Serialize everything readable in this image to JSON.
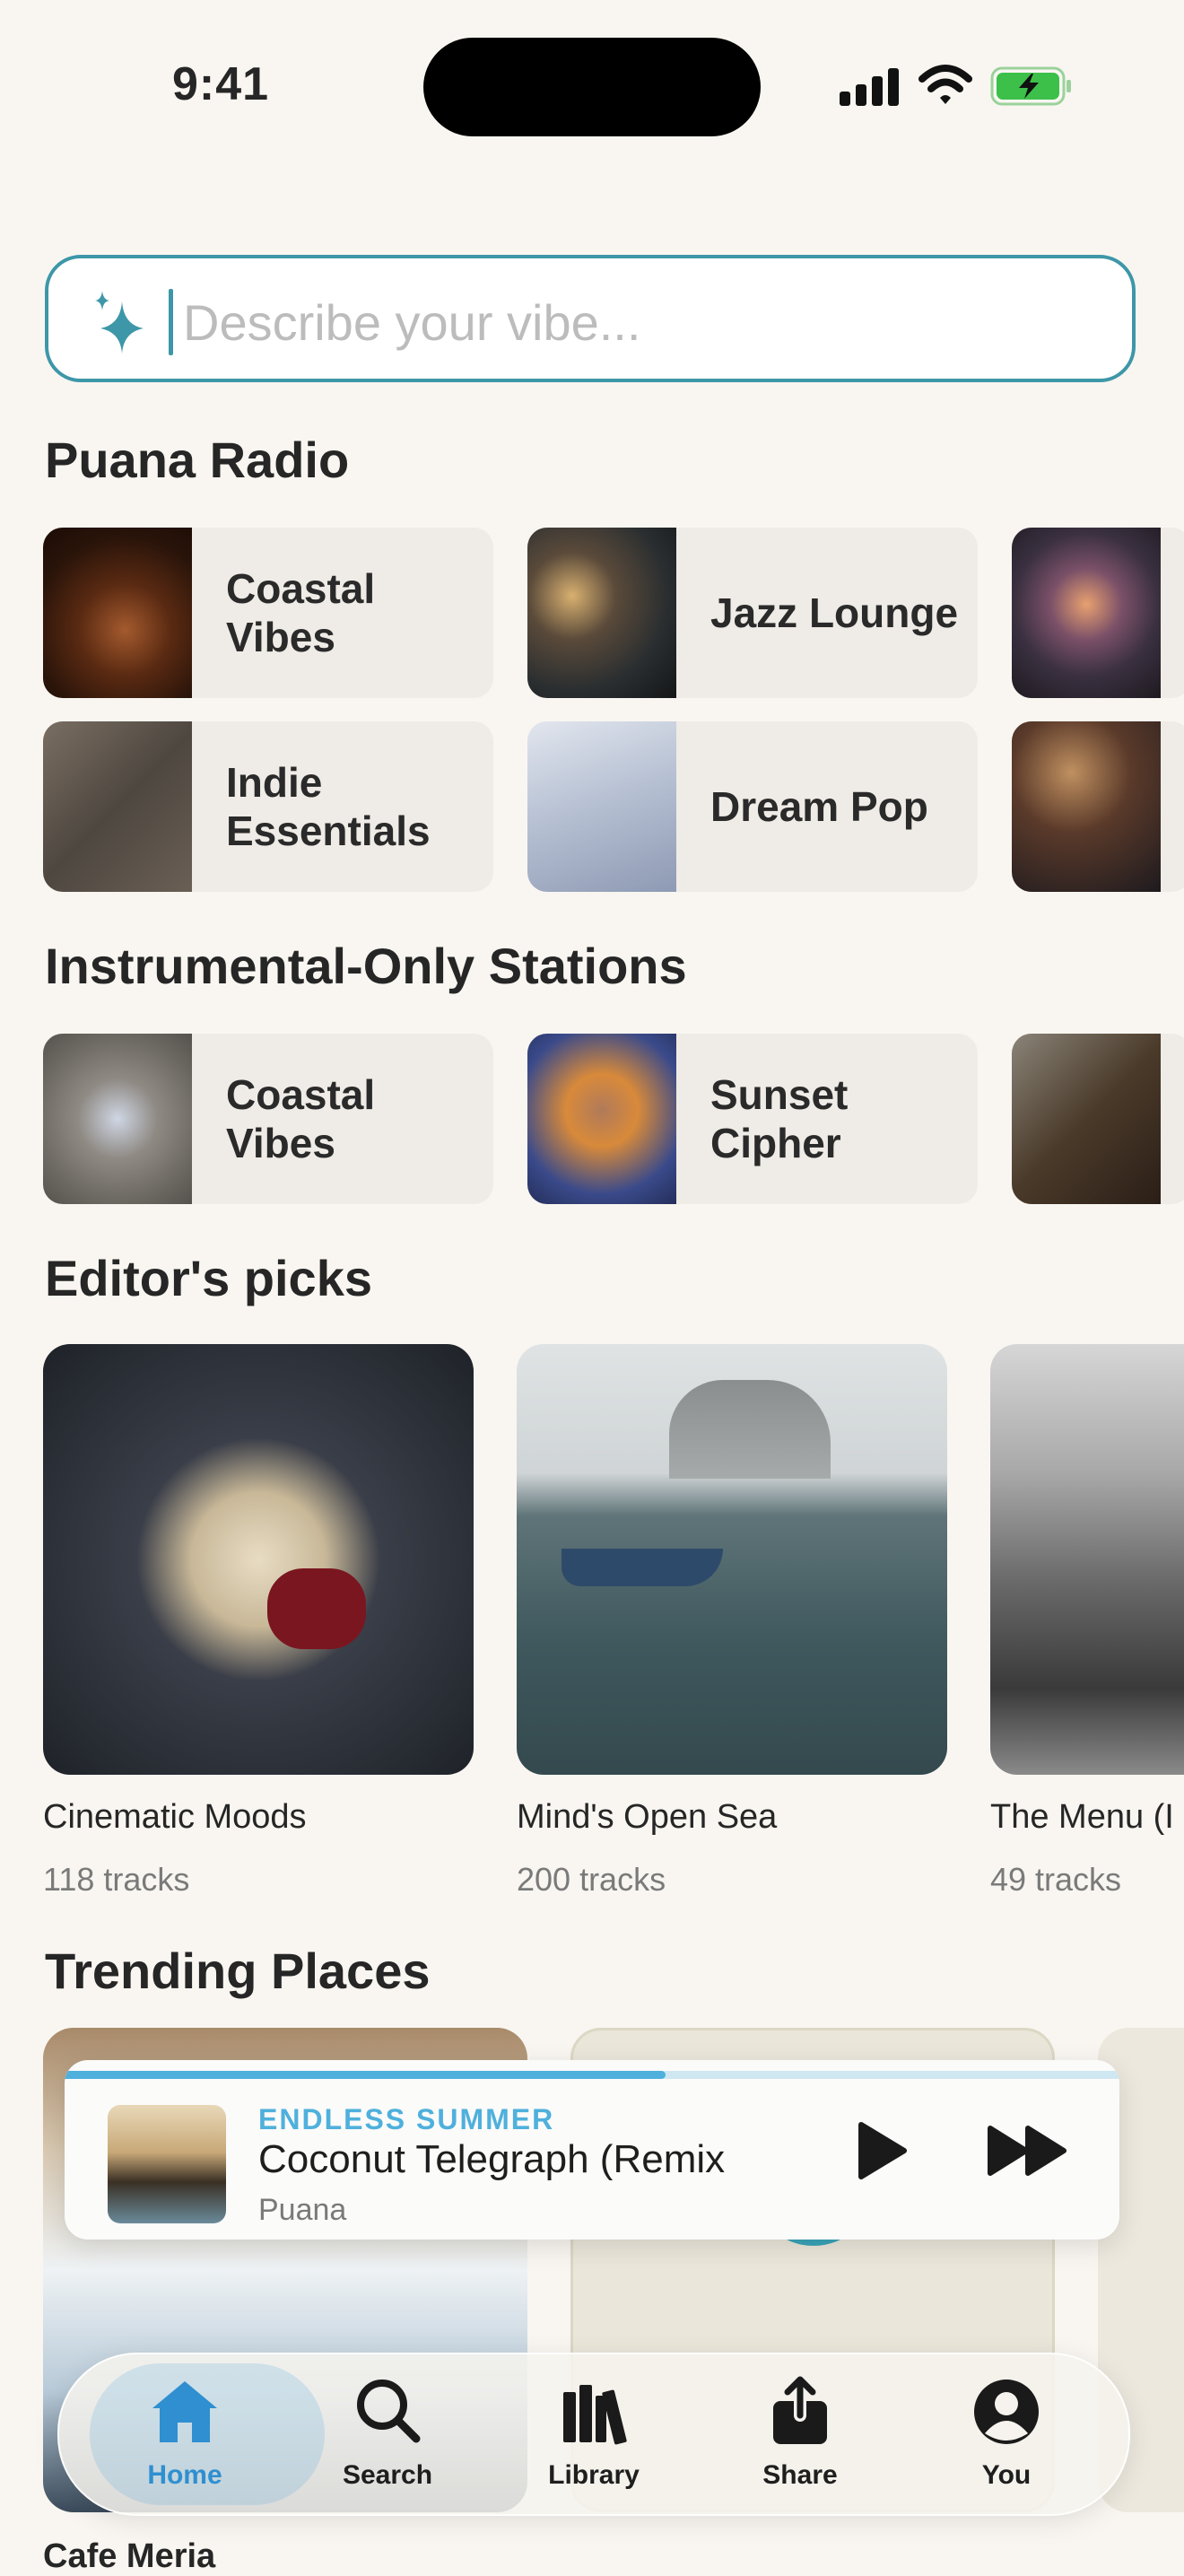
{
  "status_bar": {
    "time": "9:41"
  },
  "search": {
    "placeholder": "Describe your vibe..."
  },
  "sections": {
    "radio": "Puana Radio",
    "instrumental": "Instrumental-Only Stations",
    "picks": "Editor's picks",
    "trending": "Trending Places"
  },
  "radio_stations": [
    {
      "label": "Coastal Vibes"
    },
    {
      "label": "Jazz Lounge"
    },
    {
      "label": "Indie Essentials"
    },
    {
      "label": "Dream Pop"
    }
  ],
  "instrumental_stations": [
    {
      "label": "Coastal Vibes"
    },
    {
      "label": "Sunset Cipher"
    }
  ],
  "editors_picks": [
    {
      "title": "Cinematic Moods",
      "tracks": "118 tracks"
    },
    {
      "title": "Mind's Open Sea",
      "tracks": "200 tracks"
    },
    {
      "title": "The Menu (I",
      "tracks": "49 tracks"
    }
  ],
  "trending_places": [
    {
      "title": "Cafe Meria"
    }
  ],
  "now_playing": {
    "kicker": "ENDLESS SUMMER",
    "title": "Coconut Telegraph (Remix",
    "artist": "Puana",
    "progress": 0.57
  },
  "tabs": [
    {
      "label": "Home",
      "icon": "home-icon",
      "active": true
    },
    {
      "label": "Search",
      "icon": "magnifier-icon"
    },
    {
      "label": "Library",
      "icon": "library-icon"
    },
    {
      "label": "Share",
      "icon": "share-icon"
    },
    {
      "label": "You",
      "icon": "person-icon"
    }
  ],
  "colors": {
    "accent": "#3d97a8",
    "progress": "#4fb0dc",
    "tab_active": "#2f8fd0",
    "background": "#f9f6f1"
  }
}
